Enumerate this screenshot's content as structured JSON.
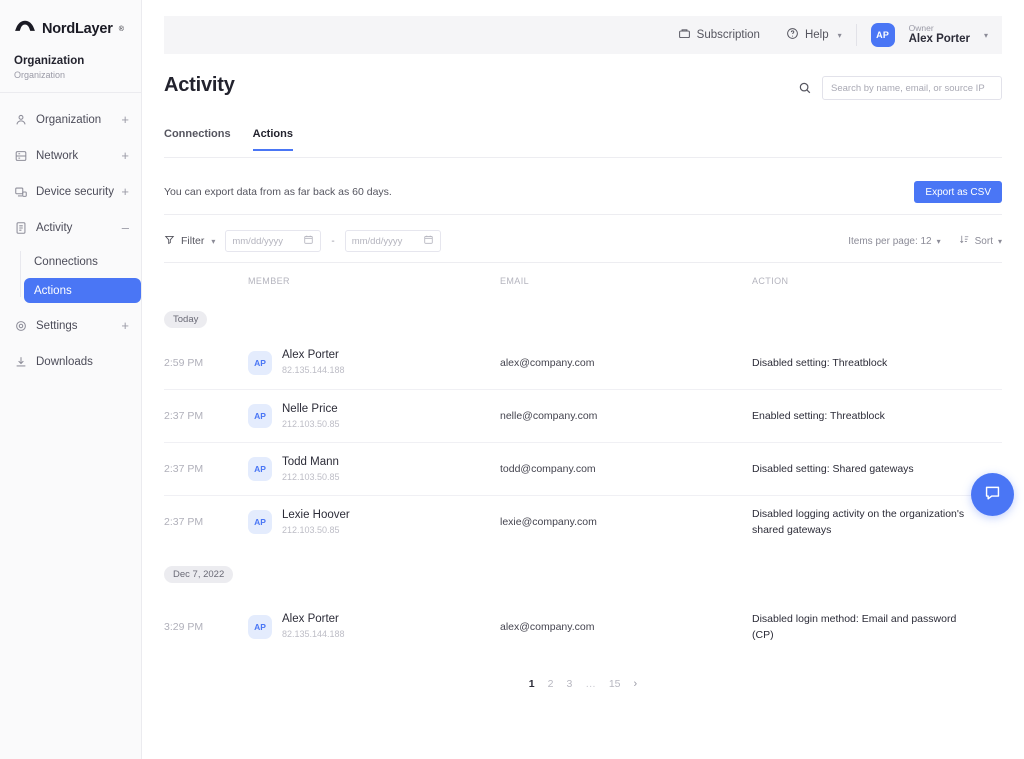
{
  "sidebar": {
    "brand": "NordLayer",
    "brand_tm": "®",
    "org_title": "Organization",
    "org_subtitle": "Organization",
    "items": [
      {
        "label": "Organization",
        "icon": "organization-icon",
        "expander": "+"
      },
      {
        "label": "Network",
        "icon": "network-icon",
        "expander": "+"
      },
      {
        "label": "Device security",
        "icon": "device-security-icon",
        "expander": "+"
      },
      {
        "label": "Activity",
        "icon": "activity-icon",
        "expander": "–"
      },
      {
        "label": "Settings",
        "icon": "gear-icon",
        "expander": "+"
      },
      {
        "label": "Downloads",
        "icon": "download-icon",
        "expander": ""
      }
    ],
    "subitems": [
      {
        "label": "Connections",
        "active": false
      },
      {
        "label": "Actions",
        "active": true
      }
    ],
    "active_color": "#4a76f5"
  },
  "topbar": {
    "subscription_label": "Subscription",
    "help_label": "Help",
    "user_initials": "AP",
    "user_role": "Owner",
    "user_name": "Alex Porter"
  },
  "page": {
    "title": "Activity"
  },
  "search": {
    "placeholder": "Search by name, email, or source IP",
    "value": ""
  },
  "tabs": [
    {
      "label": "Connections",
      "active": false
    },
    {
      "label": "Actions",
      "active": true
    }
  ],
  "export": {
    "note": "You can export data from as far back as 60 days.",
    "button_label": "Export as CSV"
  },
  "toolbar": {
    "filter_label": "Filter",
    "date_from_placeholder": "mm/dd/yyyy",
    "date_to_placeholder": "mm/dd/yyyy",
    "date_separator": "-",
    "items_per_page_label": "Items per page: 12",
    "sort_label": "Sort"
  },
  "table": {
    "columns": {
      "member": "MEMBER",
      "email": "EMAIL",
      "action": "ACTION"
    },
    "groups": [
      {
        "date_label": "Today",
        "rows": [
          {
            "time": "2:59 PM",
            "initials": "AP",
            "name": "Alex Porter",
            "ip": "82.135.144.188",
            "email": "alex@company.com",
            "action": "Disabled setting: Threatblock"
          },
          {
            "time": "2:37 PM",
            "initials": "AP",
            "name": "Nelle Price",
            "ip": "212.103.50.85",
            "email": "nelle@company.com",
            "action": "Enabled setting: Threatblock"
          },
          {
            "time": "2:37 PM",
            "initials": "AP",
            "name": "Todd Mann",
            "ip": "212.103.50.85",
            "email": "todd@company.com",
            "action": "Disabled setting: Shared gateways"
          },
          {
            "time": "2:37 PM",
            "initials": "AP",
            "name": "Lexie Hoover",
            "ip": "212.103.50.85",
            "email": "lexie@company.com",
            "action": "Disabled logging activity on the organization's shared gateways"
          }
        ]
      },
      {
        "date_label": "Dec 7, 2022",
        "rows": [
          {
            "time": "3:29 PM",
            "initials": "AP",
            "name": "Alex Porter",
            "ip": "82.135.144.188",
            "email": "alex@company.com",
            "action": "Disabled login method: Email and password (CP)"
          }
        ]
      }
    ]
  },
  "pagination": {
    "pages": [
      "1",
      "2",
      "3",
      "…",
      "15"
    ],
    "active": "1",
    "next_glyph": "›"
  },
  "chat": {
    "icon": "chat-bubble-icon"
  }
}
